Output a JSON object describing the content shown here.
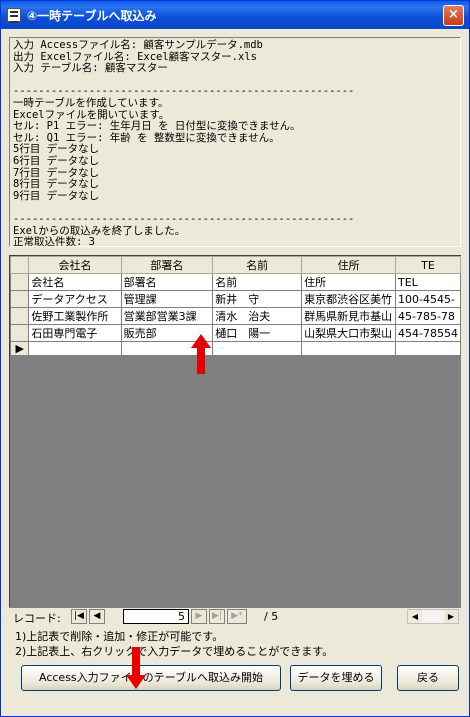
{
  "window": {
    "title": "④一時テーブルへ取込み",
    "close_label": "×"
  },
  "log": {
    "lines": [
      "入力 Accessファイル名: 顧客サンプルデータ.mdb",
      "出力 Excelファイル名: Excel顧客マスター.xls",
      "入力 テーブル名: 顧客マスター",
      "",
      "------------------------------------------------------",
      "一時テーブルを作成しています。",
      "Excelファイルを開いています。",
      "セル: P1 エラー: 生年月日 を 日付型に変換できません。",
      "セル: Q1 エラー: 年齢 を 整数型に変換できません。",
      "5行目 データなし",
      "6行目 データなし",
      "7行目 データなし",
      "8行目 データなし",
      "9行目 データなし",
      "",
      "------------------------------------------------------",
      "Exelからの取込みを終了しました。",
      "正常取込件数: 3"
    ]
  },
  "grid": {
    "headers": [
      "会社名",
      "部署名",
      "名前",
      "住所",
      "TE"
    ],
    "rows": [
      [
        "会社名",
        "部署名",
        "名前",
        "住所",
        "TEL"
      ],
      [
        "データアクセス",
        "管理課",
        "新井　守",
        "東京都渋谷区美竹",
        "100-4545-"
      ],
      [
        "佐野工業製作所",
        "営業部営業3課",
        "清水　治夫",
        "群馬県新見市基山",
        "45-785-78"
      ],
      [
        "石田専門電子",
        "販売部",
        "樋口　陽一",
        "山梨県大口市梨山",
        "454-78554"
      ],
      [
        "",
        "",
        "",
        "",
        ""
      ]
    ],
    "new_row_marker": "▶"
  },
  "navigation": {
    "label": "レコード:",
    "first": "|◀",
    "prev": "◀",
    "next": "▶",
    "last": "▶|",
    "new": "▶*",
    "current_record": "5",
    "total": "/ 5",
    "scroll_left": "◀",
    "scroll_right": "▶"
  },
  "notes": [
    "1)上記表で削除・追加・修正が可能です。",
    "2)上記表上、右クリックで入力データで埋めることができます。"
  ],
  "buttons": {
    "import_start": "Access入力ファイルのテーブルへ取込み開始",
    "fill_data": "データを埋める",
    "back": "戻る"
  },
  "colors": {
    "arrow": "#e60000",
    "titlebar": "#0a4fd6"
  }
}
